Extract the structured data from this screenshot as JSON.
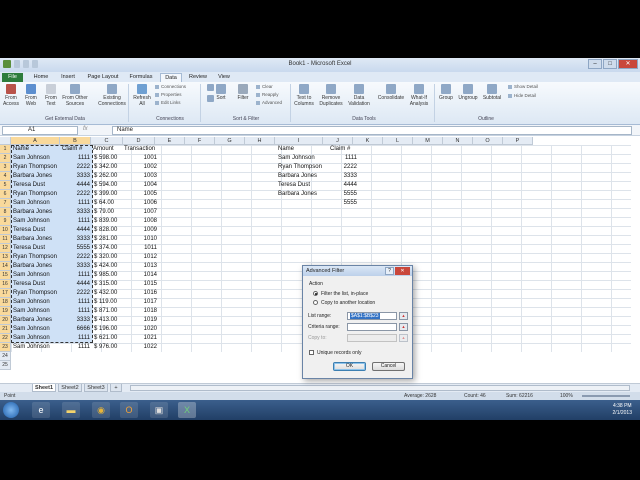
{
  "window": {
    "title": "Book1 - Microsoft Excel"
  },
  "ribbon": {
    "tabs": [
      "File",
      "Home",
      "Insert",
      "Page Layout",
      "Formulas",
      "Data",
      "Review",
      "View"
    ],
    "active_tab": "Data",
    "groups": {
      "external": {
        "label": "Get External Data",
        "buttons": [
          "From Access",
          "From Web",
          "From Text",
          "From Other Sources",
          "Existing Connections"
        ]
      },
      "connections": {
        "label": "Connections",
        "refresh": "Refresh All",
        "small": [
          "Connections",
          "Properties",
          "Edit Links"
        ]
      },
      "sortfilter": {
        "label": "Sort & Filter",
        "sort": "Sort",
        "filter": "Filter",
        "small": [
          "Clear",
          "Reapply",
          "Advanced"
        ]
      },
      "datatools": {
        "label": "Data Tools",
        "buttons": [
          "Text to Columns",
          "Remove Duplicates",
          "Data Validation",
          "Consolidate",
          "What-If Analysis"
        ]
      },
      "outline": {
        "label": "Outline",
        "buttons": [
          "Group",
          "Ungroup",
          "Subtotal"
        ],
        "small": [
          "Show Detail",
          "Hide Detail"
        ]
      }
    }
  },
  "formula_bar": {
    "name_box": "A1",
    "fx": "fx",
    "value": "Name"
  },
  "grid": {
    "columns": [
      "A",
      "B",
      "C",
      "D",
      "E",
      "F",
      "G",
      "H",
      "I",
      "J",
      "K",
      "L",
      "M",
      "N",
      "O",
      "P"
    ],
    "rows": [
      "1",
      "2",
      "3",
      "4",
      "5",
      "6",
      "7",
      "8",
      "9",
      "10",
      "11",
      "12",
      "13",
      "14",
      "15",
      "16",
      "17",
      "18",
      "19",
      "20",
      "21",
      "22",
      "23",
      "24",
      "25"
    ],
    "headers": [
      "Name",
      "Claim #",
      "Amount",
      "Transaction"
    ],
    "data": [
      [
        "Sam Johnson",
        "1111",
        "$ 598.00",
        "1001"
      ],
      [
        "Ryan Thompson",
        "2222",
        "$ 342.00",
        "1002"
      ],
      [
        "Barbara Jones",
        "3333",
        "$ 262.00",
        "1003"
      ],
      [
        "Teresa Dust",
        "4444",
        "$ 594.00",
        "1004"
      ],
      [
        "Ryan Thompson",
        "2222",
        "$ 399.00",
        "1005"
      ],
      [
        "Sam Johnson",
        "1111",
        "$  64.00",
        "1006"
      ],
      [
        "Barbara Jones",
        "3333",
        "$  79.00",
        "1007"
      ],
      [
        "Sam Johnson",
        "1111",
        "$ 839.00",
        "1008"
      ],
      [
        "Teresa Dust",
        "4444",
        "$ 828.00",
        "1009"
      ],
      [
        "Barbara Jones",
        "3333",
        "$ 281.00",
        "1010"
      ],
      [
        "Teresa Dust",
        "5555",
        "$ 374.00",
        "1011"
      ],
      [
        "Ryan Thompson",
        "2222",
        "$ 320.00",
        "1012"
      ],
      [
        "Barbara Jones",
        "3333",
        "$ 424.00",
        "1013"
      ],
      [
        "Sam Johnson",
        "1111",
        "$ 985.00",
        "1014"
      ],
      [
        "Teresa Dust",
        "4444",
        "$ 315.00",
        "1015"
      ],
      [
        "Ryan Thompson",
        "2222",
        "$ 432.00",
        "1016"
      ],
      [
        "Sam Johnson",
        "1111",
        "$ 119.00",
        "1017"
      ],
      [
        "Sam Johnson",
        "1111",
        "$ 871.00",
        "1018"
      ],
      [
        "Barbara Jones",
        "3333",
        "$ 413.00",
        "1019"
      ],
      [
        "Sam Johnson",
        "6666",
        "$ 196.00",
        "1020"
      ],
      [
        "Sam Johnson",
        "1111",
        "$ 621.00",
        "1021"
      ],
      [
        "Sam Johnson",
        "1111",
        "$ 976.00",
        "1022"
      ]
    ],
    "side_headers": [
      "Name",
      "Claim #"
    ],
    "side_data": [
      [
        "Sam Johnson",
        "1111"
      ],
      [
        "Ryan Thompson",
        "2222"
      ],
      [
        "Barbara Jones",
        "3333"
      ],
      [
        "Teresa Dust",
        "4444"
      ],
      [
        "Barbara Jones",
        "5555"
      ],
      [
        "",
        "5555"
      ]
    ]
  },
  "sheets": [
    "Sheet1",
    "Sheet2",
    "Sheet3"
  ],
  "status": {
    "mode": "Point",
    "average": "Average: 2628",
    "count": "Count: 46",
    "sum": "Sum: 62216",
    "zoom": "100%"
  },
  "dialog": {
    "title": "Advanced Filter",
    "help": "?",
    "section": "Action",
    "option1": "Filter the list, in-place",
    "option2": "Copy to another location",
    "list_label": "List range:",
    "list_value": "$A$1:$B$23",
    "criteria_label": "Criteria range:",
    "criteria_value": "",
    "copy_label": "Copy to:",
    "copy_value": "",
    "unique_label": "Unique records only",
    "ok": "OK",
    "cancel": "Cancel"
  },
  "taskbar": {
    "time": "4:38 PM",
    "date": "2/1/2013"
  },
  "colors": {
    "excel_green": "#2d7c3c",
    "selection": "#cfe1f6",
    "header_selected": "#f9d99b"
  }
}
